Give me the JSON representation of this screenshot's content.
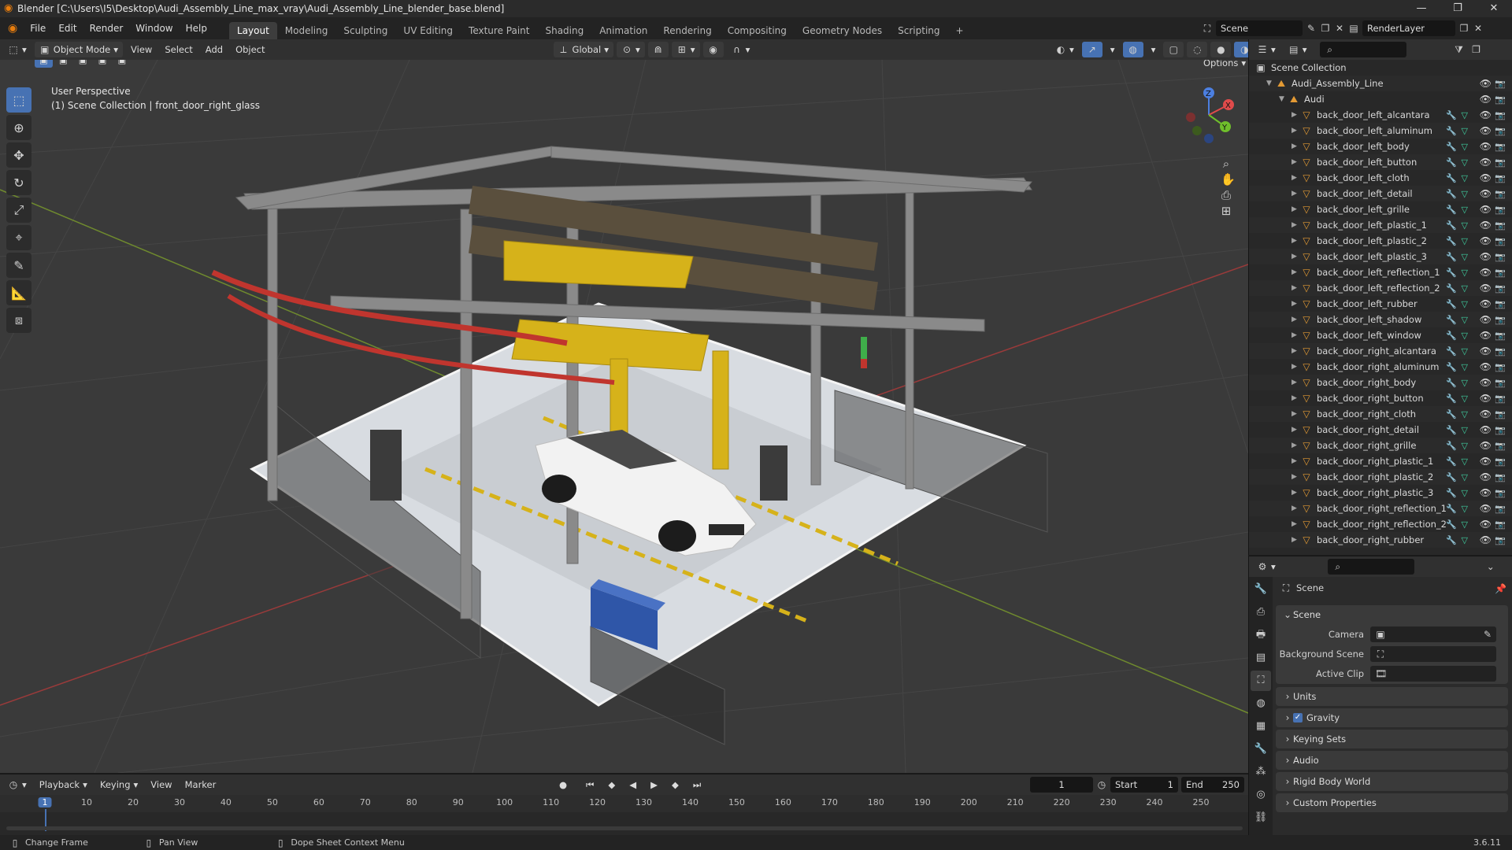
{
  "window": {
    "title": "Blender [C:\\Users\\I5\\Desktop\\Audi_Assembly_Line_max_vray\\Audi_Assembly_Line_blender_base.blend]",
    "minimize": "—",
    "restore": "❐",
    "close": "✕"
  },
  "menu": {
    "items": [
      "File",
      "Edit",
      "Render",
      "Window",
      "Help"
    ],
    "workspaces": [
      "Layout",
      "Modeling",
      "Sculpting",
      "UV Editing",
      "Texture Paint",
      "Shading",
      "Animation",
      "Rendering",
      "Compositing",
      "Geometry Nodes",
      "Scripting"
    ],
    "active_workspace": "Layout",
    "add_workspace": "+",
    "scene": "Scene",
    "view_layer": "RenderLayer"
  },
  "viewport_header": {
    "mode": "Object Mode",
    "menus": [
      "View",
      "Select",
      "Add",
      "Object"
    ],
    "orientation": "Global",
    "options": "Options"
  },
  "viewport": {
    "perspective": "User Perspective",
    "context": "(1) Scene Collection | front_door_right_glass",
    "colors": {
      "floor": "#dfe3e8",
      "frame": "#8a8a8a",
      "yellow": "#d6b21a",
      "red": "#c0352e",
      "car": "#f2f2f2",
      "fence": "#3a3a3a",
      "blue": "#2f56a8"
    }
  },
  "tools": [
    "select-box-icon",
    "cursor-icon",
    "move-icon",
    "rotate-icon",
    "scale-icon",
    "transform-icon",
    "annotate-icon",
    "measure-icon",
    "add-cube-icon"
  ],
  "outliner": {
    "search_placeholder": "",
    "scene_collection": "Scene Collection",
    "collection": "Audi_Assembly_Line",
    "sub_collection": "Audi",
    "objects": [
      "back_door_left_alcantara",
      "back_door_left_aluminum",
      "back_door_left_body",
      "back_door_left_button",
      "back_door_left_cloth",
      "back_door_left_detail",
      "back_door_left_grille",
      "back_door_left_plastic_1",
      "back_door_left_plastic_2",
      "back_door_left_plastic_3",
      "back_door_left_reflection_1",
      "back_door_left_reflection_2",
      "back_door_left_rubber",
      "back_door_left_shadow",
      "back_door_left_window",
      "back_door_right_alcantara",
      "back_door_right_aluminum",
      "back_door_right_body",
      "back_door_right_button",
      "back_door_right_cloth",
      "back_door_right_detail",
      "back_door_right_grille",
      "back_door_right_plastic_1",
      "back_door_right_plastic_2",
      "back_door_right_plastic_3",
      "back_door_right_reflection_1",
      "back_door_right_reflection_2",
      "back_door_right_rubber"
    ]
  },
  "properties": {
    "breadcrumb": "Scene",
    "panel_title": "Scene",
    "camera_label": "Camera",
    "background_scene_label": "Background Scene",
    "active_clip_label": "Active Clip",
    "sections": [
      "Units",
      "Gravity",
      "Keying Sets",
      "Audio",
      "Rigid Body World",
      "Custom Properties"
    ],
    "gravity_checked": true
  },
  "timeline": {
    "menus": [
      "Playback",
      "Keying",
      "View",
      "Marker"
    ],
    "current_frame": "1",
    "start_label": "Start",
    "start": "1",
    "end_label": "End",
    "end": "250",
    "ticks": [
      "1",
      "10",
      "20",
      "30",
      "40",
      "50",
      "60",
      "70",
      "80",
      "90",
      "100",
      "110",
      "120",
      "130",
      "140",
      "150",
      "160",
      "170",
      "180",
      "190",
      "200",
      "210",
      "220",
      "230",
      "240",
      "250"
    ]
  },
  "status": {
    "hint1": "Change Frame",
    "hint2": "Pan View",
    "hint3": "Dope Sheet Context Menu",
    "version": "3.6.11"
  }
}
